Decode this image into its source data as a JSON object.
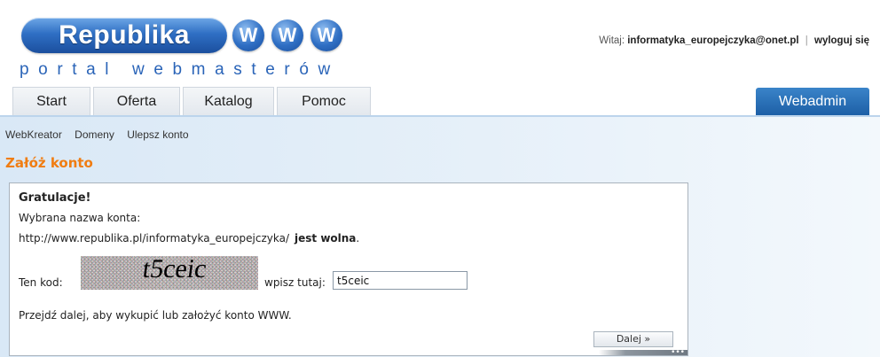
{
  "logo": {
    "name": "Republika",
    "w_letters": [
      "W",
      "W",
      "W"
    ],
    "subtitle": "portal webmasterów"
  },
  "userbar": {
    "greeting": "Witaj:",
    "email": "informatyka_europejczyka@onet.pl",
    "separator": "|",
    "logout": "wyloguj się"
  },
  "tabs": [
    {
      "label": "Start"
    },
    {
      "label": "Oferta"
    },
    {
      "label": "Katalog"
    },
    {
      "label": "Pomoc"
    }
  ],
  "tab_webadmin": "Webadmin",
  "subnav": [
    "WebKreator",
    "Domeny",
    "Ulepsz konto"
  ],
  "section_title": "Załóż konto",
  "content": {
    "congrats": "Gratulacje!",
    "chosen_label": "Wybrana nazwa konta:",
    "account_url": "http://www.republika.pl/informatyka_europejczyka/",
    "availability": "jest wolna",
    "availability_suffix": ".",
    "code_label": "Ten kod:",
    "captcha_text": "t5ceic",
    "enter_label": "wpisz tutaj:",
    "captcha_input_value": "t5ceic",
    "next_hint": "Przejdź dalej, aby wykupić lub założyć konto WWW.",
    "next_button": "Dalej »"
  },
  "colors": {
    "brand_blue": "#2f6fc4",
    "title_orange": "#f07d12",
    "panel_bg": "#d9e8f6"
  }
}
